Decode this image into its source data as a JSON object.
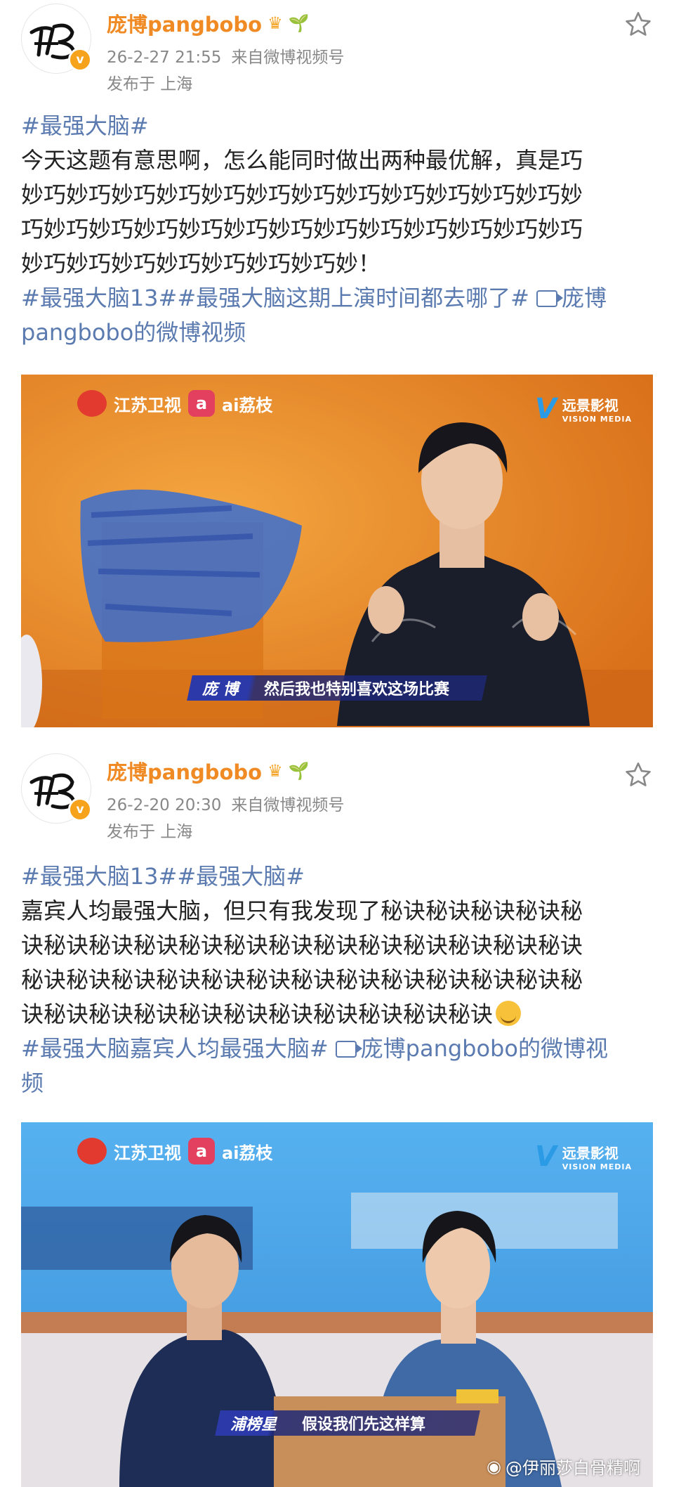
{
  "posts": [
    {
      "username": "庞博pangbobo",
      "datetime": "26-2-27 21:55",
      "source": "来自微博视频号",
      "location": "发布于 上海",
      "hashtag_top": "#最强大脑#",
      "text_lines": [
        "今天这题有意思啊，怎么能同时做出两种最优解，真是巧",
        "妙巧妙巧妙巧妙巧妙巧妙巧妙巧妙巧妙巧妙巧妙巧妙巧妙",
        "巧妙巧妙巧妙巧妙巧妙巧妙巧妙巧妙巧妙巧妙巧妙巧妙巧",
        "妙巧妙巧妙巧妙巧妙巧妙巧妙巧妙！"
      ],
      "tags_line": "#最强大脑13##最强大脑这期上演时间都去哪了#",
      "video_link_line1": "庞博",
      "video_link_line2": "pangbobo的微博视频",
      "video": {
        "channel": "江苏卫视",
        "platform": "ai荔枝",
        "producer": "远景影视",
        "producer_en": "VISION MEDIA",
        "caption_name": "庞 博",
        "caption_text": "然后我也特别喜欢这场比赛"
      }
    },
    {
      "username": "庞博pangbobo",
      "datetime": "26-2-20 20:30",
      "source": "来自微博视频号",
      "location": "发布于 上海",
      "hashtag_top": "#最强大脑13##最强大脑#",
      "text_lines": [
        "嘉宾人均最强大脑，但只有我发现了秘诀秘诀秘诀秘诀秘",
        "诀秘诀秘诀秘诀秘诀秘诀秘诀秘诀秘诀秘诀秘诀秘诀秘诀",
        "秘诀秘诀秘诀秘诀秘诀秘诀秘诀秘诀秘诀秘诀秘诀秘诀秘",
        "诀秘诀秘诀秘诀秘诀秘诀秘诀秘诀秘诀秘诀秘诀"
      ],
      "tags_line": "#最强大脑嘉宾人均最强大脑#",
      "video_link_line1": "庞博pangbobo的微博视",
      "video_link_line2": "频",
      "video": {
        "channel": "江苏卫视",
        "platform": "ai荔枝",
        "producer": "远景影视",
        "producer_en": "VISION MEDIA",
        "caption_name": "浦榜星",
        "caption_text": "假设我们先这样算"
      }
    }
  ],
  "watermark": "@伊丽莎白骨精啊",
  "colors": {
    "username": "#f08a24",
    "link": "#5b7bb0",
    "meta": "#888888",
    "video1_bg": "#e8891f",
    "video2_bg": "#4aa3e8"
  }
}
